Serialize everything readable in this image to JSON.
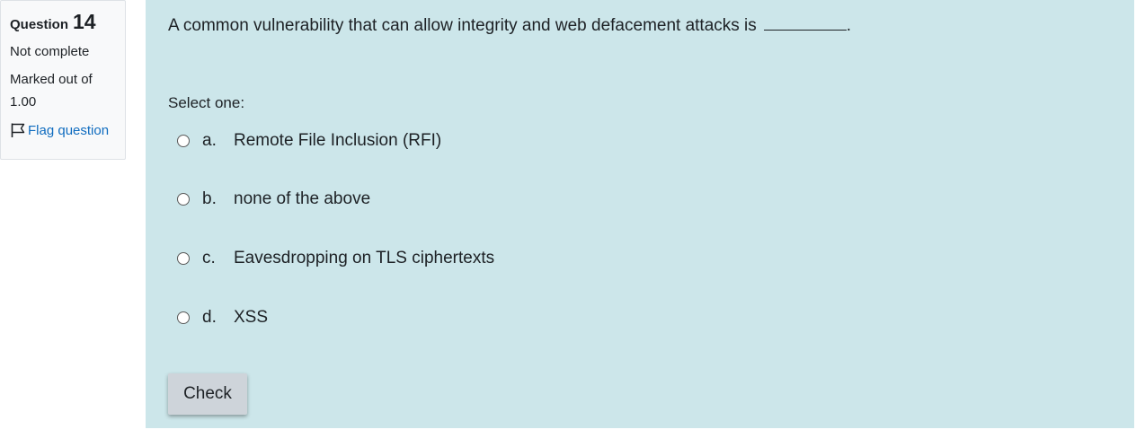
{
  "info": {
    "question_word": "Question",
    "question_number": "14",
    "state": "Not complete",
    "grade_line1": "Marked out of",
    "grade_line2": "1.00",
    "flag_label": "Flag question"
  },
  "question": {
    "text": "A common vulnerability that can allow integrity and web defacement attacks is",
    "trailing": ".",
    "prompt": "Select one:",
    "options": [
      {
        "letter": "a.",
        "text": "Remote File Inclusion (RFI)"
      },
      {
        "letter": "b.",
        "text": "none of the above"
      },
      {
        "letter": "c.",
        "text": "Eavesdropping on TLS ciphertexts"
      },
      {
        "letter": "d.",
        "text": "XSS"
      }
    ],
    "check_label": "Check"
  },
  "colors": {
    "content_bg": "#cce6ea",
    "info_bg": "#f8f9fa",
    "link": "#0f6cbf",
    "button_bg": "#ced4da"
  }
}
